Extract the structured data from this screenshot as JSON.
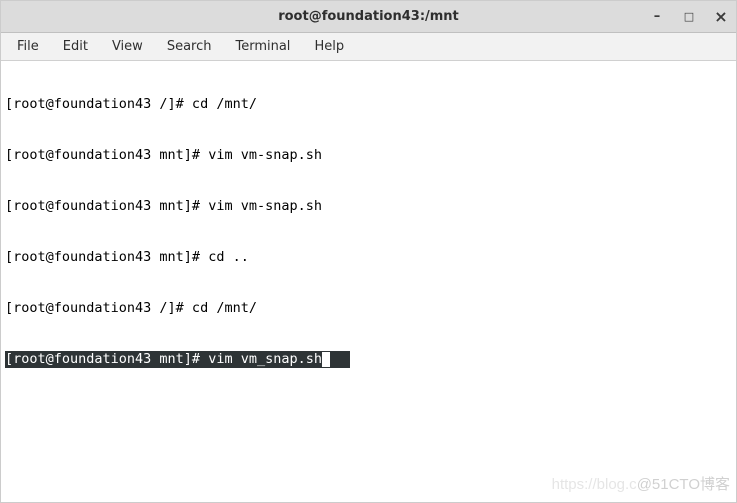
{
  "titlebar": {
    "title": "root@foundation43:/mnt"
  },
  "window_controls": {
    "minimize": "–",
    "maximize": "□",
    "close": "×"
  },
  "menubar": {
    "items": [
      {
        "label": "File"
      },
      {
        "label": "Edit"
      },
      {
        "label": "View"
      },
      {
        "label": "Search"
      },
      {
        "label": "Terminal"
      },
      {
        "label": "Help"
      }
    ]
  },
  "terminal": {
    "lines": [
      "[root@foundation43 /]# cd /mnt/",
      "[root@foundation43 mnt]# vim vm-snap.sh",
      "[root@foundation43 mnt]# vim vm-snap.sh",
      "[root@foundation43 mnt]# cd ..",
      "[root@foundation43 /]# cd /mnt/"
    ],
    "active_line": "[root@foundation43 mnt]# vim vm_snap.sh"
  },
  "watermark": {
    "prefix": "https://blog.c",
    "text": "@51CTO博客"
  }
}
